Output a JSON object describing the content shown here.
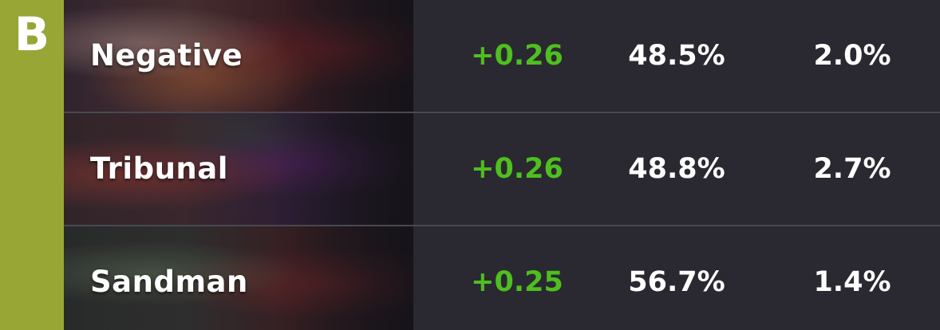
{
  "tier": {
    "letter": "B",
    "color": "#98a636"
  },
  "rows": [
    {
      "card_name": "Negative",
      "delta": "+0.26",
      "win_rate": "48.5%",
      "play_rate": "2.0%"
    },
    {
      "card_name": "Tribunal",
      "delta": "+0.26",
      "win_rate": "48.8%",
      "play_rate": "2.7%"
    },
    {
      "card_name": "Sandman",
      "delta": "+0.25",
      "win_rate": "56.7%",
      "play_rate": "1.4%"
    }
  ],
  "colors": {
    "delta_positive": "#4fbf1f",
    "stat_text": "#ffffff",
    "row_background": "#2a2931"
  }
}
